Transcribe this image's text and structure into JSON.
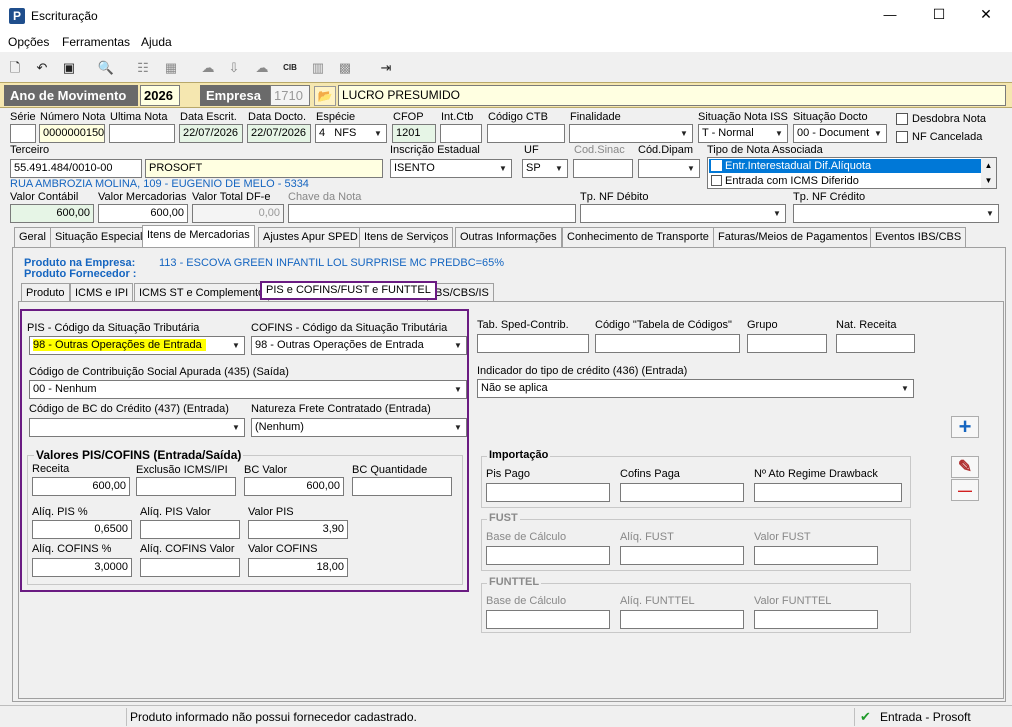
{
  "window": {
    "title": "Escrituração",
    "minimize": "—",
    "maximize": "☐",
    "close": "✕",
    "logo": "P"
  },
  "menu": [
    "Opções",
    "Ferramentas",
    "Ajuda"
  ],
  "header": {
    "ano_label": "Ano de Movimento",
    "ano_value": "2026",
    "empresa_label": "Empresa",
    "empresa_code": "1710",
    "empresa_name": "LUCRO PRESUMIDO"
  },
  "row1": {
    "serie_label": "Série",
    "serie_value": "",
    "numero_label": "Número Nota",
    "numero_value": "0000000150",
    "ultima_label": "Ultima Nota",
    "ultima_value": "",
    "data_escrit_label": "Data Escrit.",
    "data_escrit_value": "22/07/2026",
    "data_docto_label": "Data Docto.",
    "data_docto_value": "22/07/2026",
    "especie_label": "Espécie",
    "especie_code": "4",
    "especie_value": "NFS",
    "cfop_label": "CFOP",
    "cfop_value": "1201",
    "intctb_label": "Int.Ctb",
    "intctb_value": "",
    "codctb_label": "Código CTB",
    "codctb_value": "",
    "finalidade_label": "Finalidade",
    "finalidade_value": "",
    "sit_iss_label": "Situação Nota ISS",
    "sit_iss_value": "T - Normal",
    "sit_docto_label": "Situação Docto",
    "sit_docto_value": "00 - Document",
    "desdobra_label": "Desdobra Nota",
    "nf_cancelada_label": "NF Cancelada"
  },
  "row2": {
    "terceiro_label": "Terceiro",
    "terceiro_cnpj": "55.491.484/0010-00",
    "terceiro_nome": "PROSOFT",
    "ie_label": "Inscrição Estadual",
    "ie_value": "ISENTO",
    "uf_label": "UF",
    "uf_value": "SP",
    "codsinac_label": "Cod.Sinac",
    "coddipam_label": "Cód.Dipam",
    "tipo_nota_label": "Tipo de Nota Associada",
    "tipo_nota_items": [
      "Entr.Interestadual Dif.Alíquota",
      "Entrada com ICMS Diferido"
    ],
    "endereco": "RUA AMBROZIA MOLINA, 109 - EUGENIO DE MELO - 5334"
  },
  "row3": {
    "valor_contabil_label": "Valor Contábil",
    "valor_contabil_value": "600,00",
    "valor_merc_label": "Valor Mercadorias",
    "valor_merc_value": "600,00",
    "valor_dfe_label": "Valor Total DF-e",
    "valor_dfe_value": "0,00",
    "chave_label": "Chave da Nota",
    "tp_debito_label": "Tp. NF Débito",
    "tp_credito_label": "Tp. NF Crédito"
  },
  "main_tabs": [
    "Geral",
    "Situação Especial",
    "Itens de Mercadorias",
    "Ajustes Apur SPED",
    "Itens de Serviços",
    "Outras Informações",
    "Conhecimento de Transporte",
    "Faturas/Meios de Pagamentos",
    "Eventos IBS/CBS"
  ],
  "produto": {
    "empresa_label": "Produto na Empresa:",
    "empresa_value": "113 - ESCOVA GREEN INFANTIL LOL SURPRISE MC PREDBC=65%",
    "fornecedor_label": "Produto Fornecedor :"
  },
  "sub_tabs": [
    "Produto",
    "ICMS e IPI",
    "ICMS ST e Complemento",
    "PIS e COFINS/FUST e FUNTTEL",
    "IBS/CBS/IS"
  ],
  "pis": {
    "pis_cst_label": "PIS - Código da Situação Tributária",
    "pis_cst_value": "98 - Outras Operações de Entrada",
    "cofins_cst_label": "COFINS - Código da Situação Tributária",
    "cofins_cst_value": "98 - Outras Operações de Entrada",
    "contrib_label": "Código de Contribuição Social Apurada (435)    (Saída)",
    "contrib_value": "00 - Nenhum",
    "bc_credito_label": "Código de BC do Crédito (437) (Entrada)",
    "bc_credito_value": "",
    "frete_label": "Natureza Frete Contratado   (Entrada)",
    "frete_value": "(Nenhum)",
    "valores_title": "Valores PIS/COFINS (Entrada/Saída)",
    "receita_label": "Receita",
    "receita_value": "600,00",
    "exclusao_label": "Exclusão ICMS/IPI",
    "exclusao_value": "",
    "bc_valor_label": "BC Valor",
    "bc_valor_value": "600,00",
    "bc_qtd_label": "BC Quantidade",
    "bc_qtd_value": "",
    "aliq_pis_label": "Alíq. PIS %",
    "aliq_pis_value": "0,6500",
    "aliq_pis_valor_label": "Alíq. PIS Valor",
    "aliq_pis_valor_value": "",
    "valor_pis_label": "Valor PIS",
    "valor_pis_value": "3,90",
    "aliq_cofins_label": "Alíq. COFINS %",
    "aliq_cofins_value": "3,0000",
    "aliq_cofins_valor_label": "Alíq. COFINS Valor",
    "aliq_cofins_valor_value": "",
    "valor_cofins_label": "Valor COFINS",
    "valor_cofins_value": "18,00"
  },
  "right": {
    "tab_sped_label": "Tab. Sped-Contrib.",
    "cod_tabela_label": "Código \"Tabela de Códigos\"",
    "grupo_label": "Grupo",
    "nat_receita_label": "Nat. Receita",
    "indicador_label": "Indicador do tipo de crédito (436)   (Entrada)",
    "indicador_value": "Não se aplica",
    "importacao_title": "Importação",
    "pis_pago_label": "Pis Pago",
    "cofins_paga_label": "Cofins Paga",
    "ato_label": "Nº Ato Regime Drawback",
    "fust_title": "FUST",
    "fust_base_label": "Base de Cálculo",
    "fust_aliq_label": "Alíq. FUST",
    "fust_valor_label": "Valor FUST",
    "funttel_title": "FUNTTEL",
    "funttel_base_label": "Base de Cálculo",
    "funttel_aliq_label": "Alíq. FUNTTEL",
    "funttel_valor_label": "Valor FUNTTEL"
  },
  "buttons": {
    "add": "+",
    "edit": "✎",
    "remove": "—"
  },
  "status": {
    "message": "Produto informado não possui fornecedor cadastrado.",
    "check": "✔",
    "mode": "Entrada - Prosoft"
  },
  "colors": {
    "accent": "#6a1b82",
    "header_band": "#f5e7b0",
    "highlight": "#ffff00",
    "blue_text": "#1565c0"
  }
}
